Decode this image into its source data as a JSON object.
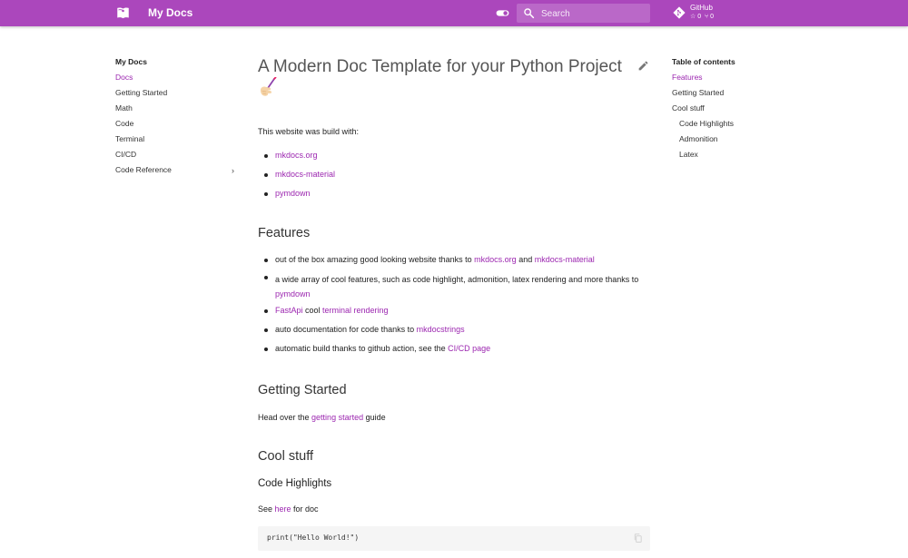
{
  "header": {
    "site_title": "My Docs",
    "search_placeholder": "Search",
    "repo_name": "GitHub",
    "repo_stars": "☆ 0",
    "repo_forks": "⑂ 0"
  },
  "nav": {
    "title": "My Docs",
    "items": [
      {
        "label": "Docs",
        "active": true
      },
      {
        "label": "Getting Started"
      },
      {
        "label": "Math"
      },
      {
        "label": "Code"
      },
      {
        "label": "Terminal"
      },
      {
        "label": "CI/CD"
      },
      {
        "label": "Code Reference"
      }
    ]
  },
  "toc": {
    "title": "Table of contents",
    "items": [
      {
        "label": "Features"
      },
      {
        "label": "Getting Started"
      },
      {
        "label": "Cool stuff"
      },
      {
        "label": "Code Highlights"
      },
      {
        "label": "Admonition"
      },
      {
        "label": "Latex"
      }
    ]
  },
  "content": {
    "title": "A Modern Doc Template for your Python Project",
    "intro": "This website was build with:",
    "built_with": [
      "mkdocs.org",
      "mkdocs-material",
      "pymdown"
    ],
    "features_heading": "Features",
    "features": {
      "f1_text": "out of the box amazing good looking website thanks to ",
      "f1_link1": "mkdocs.org",
      "f1_and": " and ",
      "f1_link2": "mkdocs-material",
      "f2_text": "a wide array of cool features, such as code highlight, admonition, latex rendering and more thanks to ",
      "f2_link": "pymdown",
      "f3_link1": "FastApi",
      "f3_text": " cool ",
      "f3_link2": "terminal rendering",
      "f4_text": "auto documentation for code thanks to ",
      "f4_link": "mkdocstrings",
      "f5_text": "automatic build thanks to github action, see the ",
      "f5_link": "CI/CD page"
    },
    "getting_started_heading": "Getting Started",
    "gs_text_1": "Head over the ",
    "gs_link": "getting started",
    "gs_text_2": " guide",
    "cool_heading": "Cool stuff",
    "code_highlights_heading": "Code Highlights",
    "see_text_1": "See ",
    "see_link": "here",
    "see_text_2": " for doc",
    "code": "print(\"Hello World!\")"
  },
  "colors": {
    "primary": "#ab47bc",
    "link": "#9c27b0"
  },
  "icons": {
    "logo": "book-icon",
    "toggle": "palette-toggle-icon",
    "search": "search-icon",
    "repo": "git-icon",
    "edit": "pencil-icon",
    "emoji": "writing-hand-emoji",
    "copy": "copy-icon",
    "chevron": "chevron-right-icon"
  }
}
